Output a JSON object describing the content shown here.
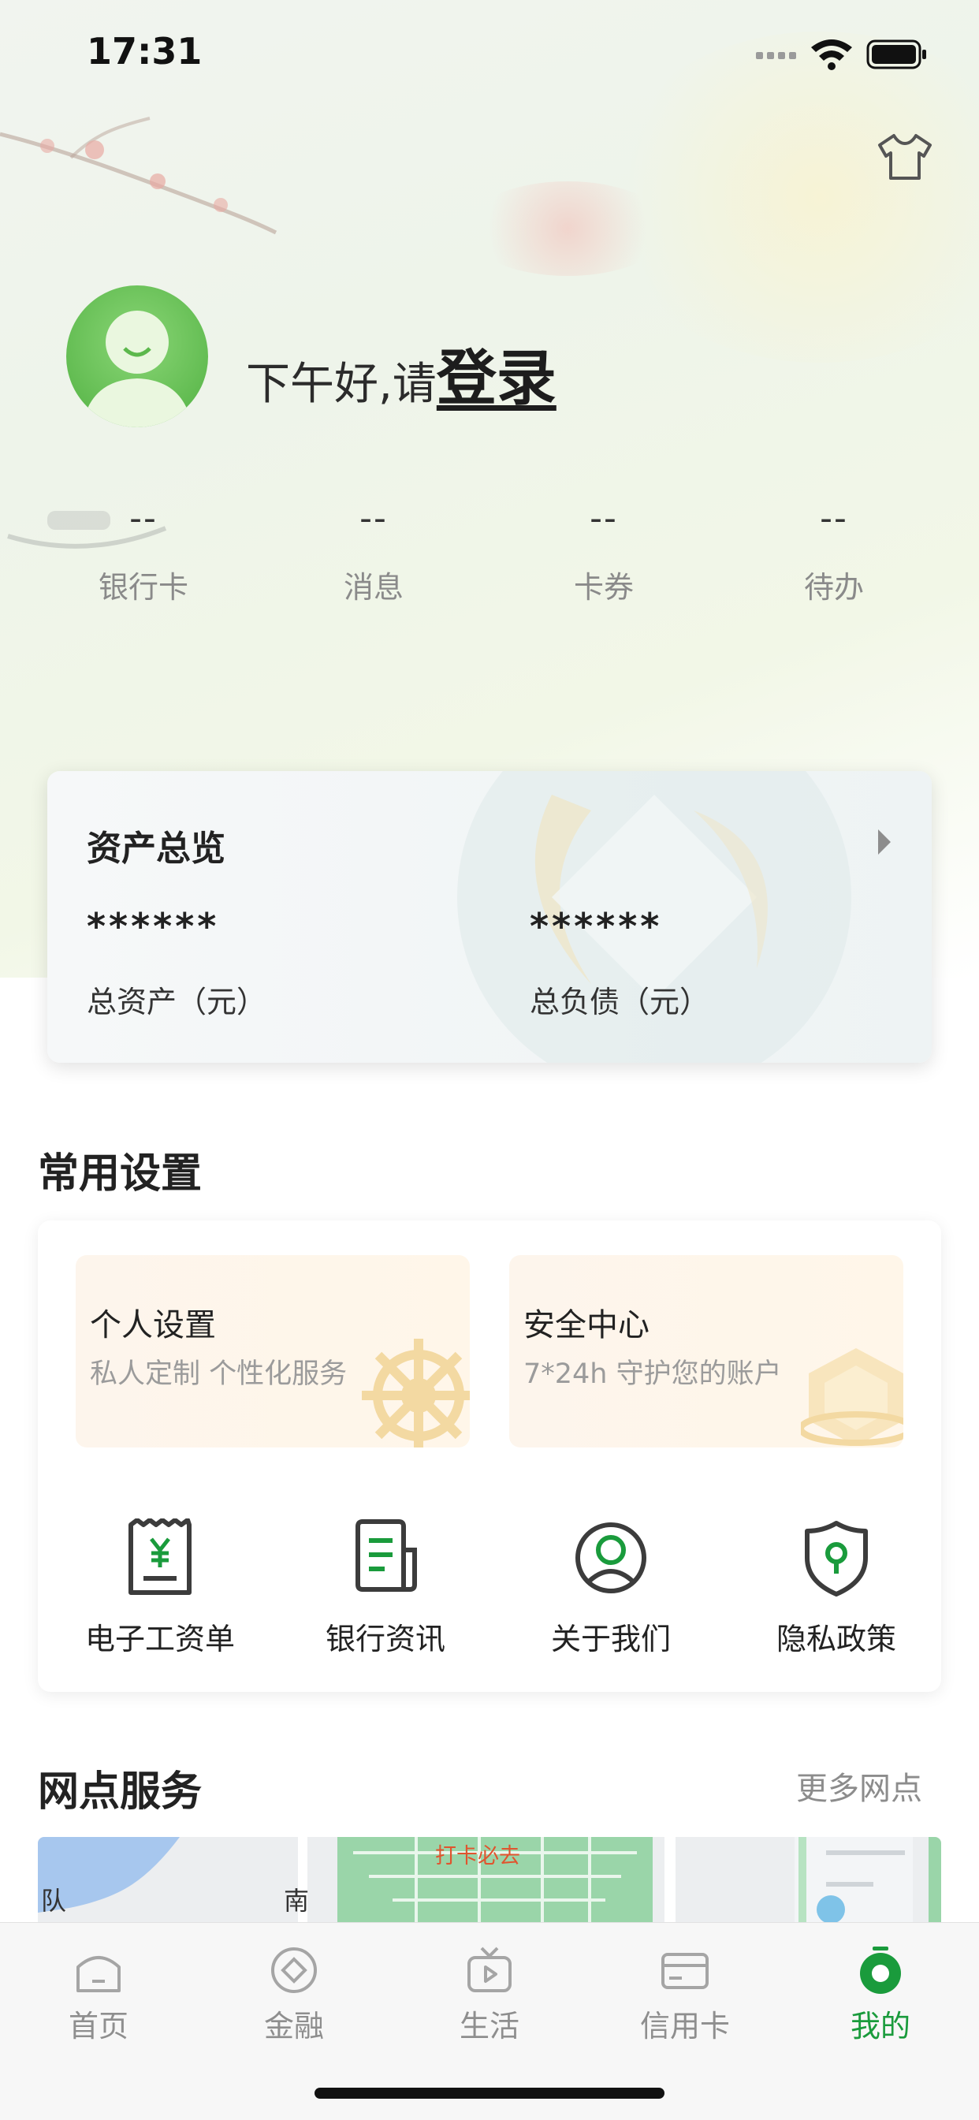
{
  "status_bar": {
    "time": "17:31"
  },
  "profile": {
    "greeting": "下午好,请",
    "login_label": "登录"
  },
  "stats": [
    {
      "value": "--",
      "label": "银行卡"
    },
    {
      "value": "--",
      "label": "消息"
    },
    {
      "value": "--",
      "label": "卡券"
    },
    {
      "value": "--",
      "label": "待办"
    }
  ],
  "assets": {
    "title": "资产总览",
    "total_assets_value": "******",
    "total_assets_label": "总资产（元）",
    "total_liabilities_value": "******",
    "total_liabilities_label": "总负债（元）"
  },
  "common_settings": {
    "title": "常用设置",
    "features": [
      {
        "title": "个人设置",
        "subtitle": "私人定制 个性化服务",
        "icon": "helm-icon"
      },
      {
        "title": "安全中心",
        "subtitle": "7*24h 守护您的账户",
        "icon": "shield-badge-icon"
      }
    ],
    "tools": [
      {
        "label": "电子工资单",
        "icon": "payslip-icon"
      },
      {
        "label": "银行资讯",
        "icon": "news-icon"
      },
      {
        "label": "关于我们",
        "icon": "user-circle-icon"
      },
      {
        "label": "隐私政策",
        "icon": "privacy-shield-icon"
      }
    ]
  },
  "branch_service": {
    "title": "网点服务",
    "more_label": "更多网点",
    "map_labels": {
      "poi": "打卡必去",
      "left": "队",
      "road": "南"
    }
  },
  "tabbar": {
    "items": [
      {
        "label": "首页",
        "icon": "home-icon",
        "active": false
      },
      {
        "label": "金融",
        "icon": "finance-icon",
        "active": false
      },
      {
        "label": "生活",
        "icon": "tv-icon",
        "active": false
      },
      {
        "label": "信用卡",
        "icon": "credit-card-icon",
        "active": false
      },
      {
        "label": "我的",
        "icon": "mine-icon",
        "active": true
      }
    ]
  },
  "colors": {
    "brand_green": "#1a9b3c",
    "avatar_green": "#5cb84c",
    "feature_bg": "#fdf5ec"
  }
}
